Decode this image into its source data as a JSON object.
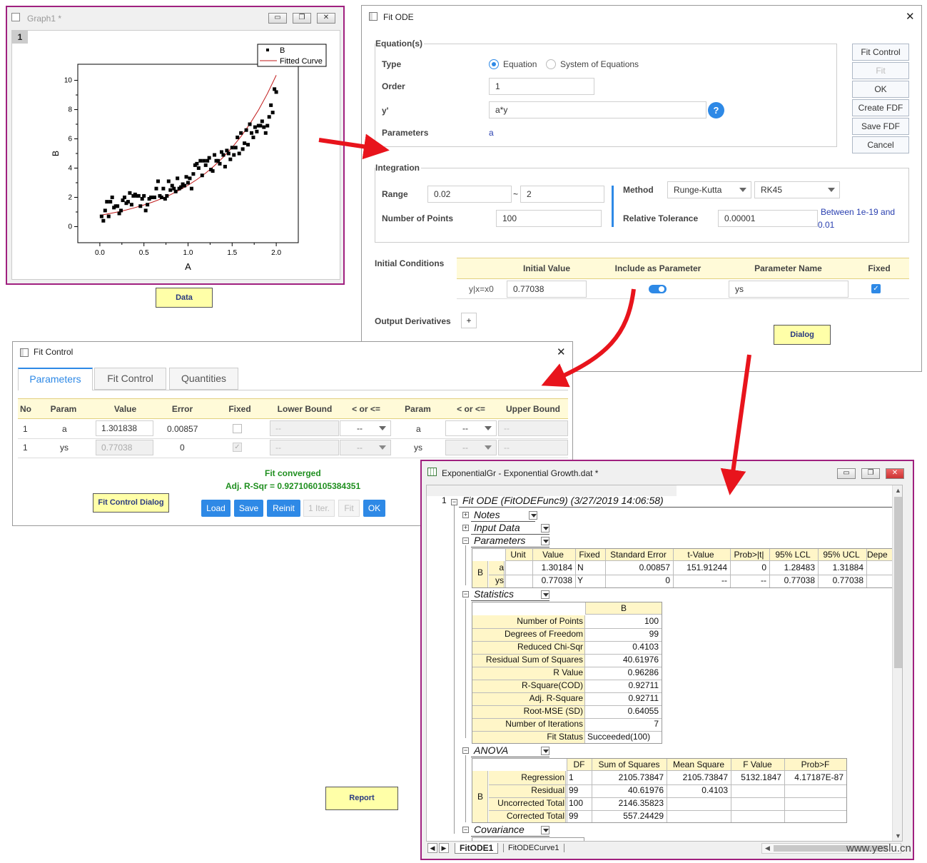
{
  "graph_window": {
    "title": "Graph1 *",
    "layer": "1",
    "legend": [
      "B",
      "Fitted Curve"
    ],
    "xlabel": "A",
    "ylabel": "B",
    "xticks": [
      "0.0",
      "0.5",
      "1.0",
      "1.5",
      "2.0"
    ],
    "yticks": [
      "0",
      "2",
      "4",
      "6",
      "8",
      "10"
    ],
    "caption": "Data"
  },
  "chart_data": {
    "type": "scatter",
    "title": "",
    "xlabel": "A",
    "ylabel": "B",
    "xlim": [
      -0.25,
      2.25
    ],
    "ylim": [
      -1.1,
      11.1
    ],
    "series": [
      {
        "name": "B",
        "type": "scatter",
        "x": [
          0.02,
          0.04,
          0.06,
          0.08,
          0.1,
          0.12,
          0.14,
          0.16,
          0.18,
          0.2,
          0.22,
          0.24,
          0.26,
          0.28,
          0.3,
          0.32,
          0.34,
          0.36,
          0.38,
          0.4,
          0.42,
          0.44,
          0.46,
          0.48,
          0.5,
          0.52,
          0.54,
          0.56,
          0.58,
          0.6,
          0.62,
          0.64,
          0.66,
          0.68,
          0.7,
          0.72,
          0.74,
          0.76,
          0.78,
          0.8,
          0.82,
          0.84,
          0.86,
          0.88,
          0.9,
          0.92,
          0.94,
          0.96,
          0.98,
          1.0,
          1.02,
          1.04,
          1.06,
          1.08,
          1.1,
          1.12,
          1.14,
          1.16,
          1.18,
          1.2,
          1.22,
          1.24,
          1.26,
          1.28,
          1.3,
          1.32,
          1.34,
          1.36,
          1.38,
          1.4,
          1.42,
          1.44,
          1.46,
          1.48,
          1.5,
          1.52,
          1.54,
          1.56,
          1.58,
          1.6,
          1.62,
          1.64,
          1.66,
          1.68,
          1.7,
          1.72,
          1.74,
          1.76,
          1.78,
          1.8,
          1.82,
          1.84,
          1.86,
          1.88,
          1.9,
          1.92,
          1.94,
          1.96,
          1.98,
          2.0
        ],
        "y": [
          0.7,
          0.4,
          1.1,
          1.7,
          0.7,
          1.7,
          2.0,
          1.3,
          1.4,
          1.4,
          0.9,
          1.1,
          1.8,
          2.0,
          1.6,
          1.7,
          2.3,
          1.5,
          2.1,
          2.2,
          2.1,
          2.1,
          1.4,
          1.9,
          2.1,
          1.1,
          1.5,
          1.9,
          2.0,
          2.0,
          2.0,
          2.6,
          3.1,
          2.1,
          2.0,
          2.6,
          1.9,
          2.1,
          3.1,
          2.5,
          2.8,
          2.6,
          2.4,
          3.3,
          2.6,
          2.7,
          2.9,
          2.8,
          3.4,
          3.0,
          3.3,
          2.6,
          3.6,
          4.2,
          4.3,
          4.0,
          4.5,
          3.5,
          4.5,
          4.2,
          4.5,
          4.7,
          3.9,
          3.8,
          4.9,
          4.5,
          4.5,
          4.3,
          5.1,
          4.9,
          4.1,
          5.2,
          5.0,
          4.6,
          5.4,
          4.9,
          5.4,
          6.1,
          5.0,
          6.4,
          5.3,
          5.7,
          6.6,
          5.6,
          7.0,
          6.4,
          6.1,
          6.8,
          6.5,
          6.9,
          6.9,
          7.2,
          6.8,
          6.4,
          6.9,
          7.5,
          8.3,
          7.8,
          9.4,
          9.2
        ]
      },
      {
        "name": "Fitted Curve",
        "type": "line",
        "x": [
          0.0,
          0.1,
          0.2,
          0.3,
          0.4,
          0.5,
          0.6,
          0.7,
          0.8,
          0.9,
          1.0,
          1.1,
          1.2,
          1.3,
          1.4,
          1.5,
          1.6,
          1.7,
          1.8,
          1.9,
          2.0
        ],
        "y": [
          0.77,
          0.88,
          1.0,
          1.14,
          1.3,
          1.48,
          1.68,
          1.91,
          2.18,
          2.48,
          2.83,
          3.22,
          3.66,
          4.17,
          4.75,
          5.41,
          6.16,
          7.01,
          7.98,
          9.09,
          10.35
        ]
      }
    ],
    "legend_position": "top-right",
    "grid": false
  },
  "fit_ode": {
    "title": "Fit ODE",
    "close_glyph": "✕",
    "eq_group": "Equation(s)",
    "type_label": "Type",
    "type_opt1": "Equation",
    "type_opt2": "System of Equations",
    "order_label": "Order",
    "order_value": "1",
    "yprime_label": "y'",
    "yprime_value": "a*y",
    "help_glyph": "?",
    "params_label": "Parameters",
    "params_value": "a",
    "buttons": {
      "fit_control": "Fit Control",
      "fit": "Fit",
      "ok": "OK",
      "create_fdf": "Create FDF",
      "save_fdf": "Save FDF",
      "cancel": "Cancel"
    },
    "int_group": "Integration",
    "range_label": "Range",
    "range_from": "0.02",
    "range_sep": "~",
    "range_to": "2",
    "npts_label": "Number of Points",
    "npts_value": "100",
    "method_label": "Method",
    "method1": "Runge-Kutta",
    "method2": "RK45",
    "tol_label": "Relative Tolerance",
    "tol_value": "0.00001",
    "tol_hint_1": "Between 1e-19 and",
    "tol_hint_2": "0.01",
    "ic_label": "Initial Conditions",
    "ic_headers": [
      "Initial Value",
      "Include as Parameter",
      "Parameter Name",
      "Fixed"
    ],
    "ic_row": {
      "name": "y|x=x0",
      "value": "0.77038",
      "param_name": "ys"
    },
    "outder_label": "Output Derivatives",
    "outder_btn": "+",
    "caption": "Dialog"
  },
  "fit_control": {
    "title": "Fit Control",
    "close_glyph": "✕",
    "tabs": [
      "Parameters",
      "Fit Control",
      "Quantities"
    ],
    "headers": [
      "No",
      "Param",
      "Value",
      "Error",
      "Fixed",
      "Lower Bound",
      "< or <=",
      "Param",
      "< or <=",
      "Upper Bound"
    ],
    "rows": [
      {
        "no": "1",
        "param": "a",
        "value": "1.301838",
        "error": "0.00857",
        "lb": "--",
        "op": "--",
        "param2": "a",
        "op2": "--",
        "ub": "--"
      },
      {
        "no": "1",
        "param": "ys",
        "value": "0.77038",
        "error": "0",
        "lb": "--",
        "op": "--",
        "param2": "ys",
        "op2": "--",
        "ub": "--"
      }
    ],
    "status1": "Fit converged",
    "status2": "Adj. R-Sqr = 0.9271060105384351",
    "buttons": {
      "load": "Load",
      "save": "Save",
      "reinit": "Reinit",
      "iter": "1 Iter.",
      "fit": "Fit",
      "ok": "OK"
    },
    "caption": "Fit Control Dialog",
    "report_caption": "Report"
  },
  "report_window": {
    "title": "ExponentialGr - Exponential Growth.dat *",
    "row_num": "1",
    "heading": "Fit ODE (FitODEFunc9) (3/27/2019 14:06:58)",
    "sections": [
      "Notes",
      "Input Data",
      "Parameters",
      "Statistics",
      "ANOVA",
      "Covariance"
    ],
    "param_headers": [
      "Unit",
      "Value",
      "Fixed",
      "Standard Error",
      "t-Value",
      "Prob>|t|",
      "95% LCL",
      "95% UCL",
      "Depe"
    ],
    "param_group": "B",
    "param_rows": [
      {
        "name": "a",
        "unit": "",
        "value": "1.30184",
        "fixed": "N",
        "se": "0.00857",
        "t": "151.91244",
        "p": "0",
        "lcl": "1.28483",
        "ucl": "1.31884"
      },
      {
        "name": "ys",
        "unit": "",
        "value": "0.77038",
        "fixed": "Y",
        "se": "0",
        "t": "--",
        "p": "--",
        "lcl": "0.77038",
        "ucl": "0.77038"
      }
    ],
    "stats_col": "B",
    "stats_rows": [
      {
        "k": "Number of Points",
        "v": "100"
      },
      {
        "k": "Degrees of Freedom",
        "v": "99"
      },
      {
        "k": "Reduced Chi-Sqr",
        "v": "0.4103"
      },
      {
        "k": "Residual Sum of Squares",
        "v": "40.61976"
      },
      {
        "k": "R Value",
        "v": "0.96286"
      },
      {
        "k": "R-Square(COD)",
        "v": "0.92711"
      },
      {
        "k": "Adj. R-Square",
        "v": "0.92711"
      },
      {
        "k": "Root-MSE (SD)",
        "v": "0.64055"
      },
      {
        "k": "Number of Iterations",
        "v": "7"
      },
      {
        "k": "Fit Status",
        "v": "Succeeded(100)"
      }
    ],
    "anova_headers": [
      "DF",
      "Sum of Squares",
      "Mean Square",
      "F Value",
      "Prob>F"
    ],
    "anova_group": "B",
    "anova_rows": [
      {
        "k": "Regression",
        "df": "1",
        "ss": "2105.73847",
        "ms": "2105.73847",
        "f": "5132.1847",
        "p": "4.17187E-87"
      },
      {
        "k": "Residual",
        "df": "99",
        "ss": "40.61976",
        "ms": "0.4103",
        "f": "",
        "p": ""
      },
      {
        "k": "Uncorrected Total",
        "df": "100",
        "ss": "2146.35823",
        "ms": "",
        "f": "",
        "p": ""
      },
      {
        "k": "Corrected Total",
        "df": "99",
        "ss": "557.24429",
        "ms": "",
        "f": "",
        "p": ""
      }
    ],
    "sheet_tabs": [
      "FitODE1",
      "FitODECurve1"
    ]
  },
  "watermark": "www.yeslu.cn",
  "colors": {
    "accent_blue": "#2e89e6",
    "graph_border": "#a0207f",
    "arrow": "#e8141c",
    "fit_green": "#1f8f1f",
    "caption_bg": "#ffffa8"
  }
}
